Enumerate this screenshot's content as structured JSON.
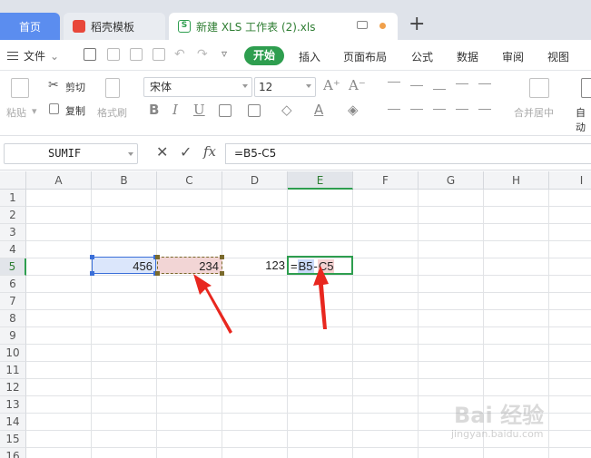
{
  "tabs": {
    "home": "首页",
    "daoke": "稻壳模板",
    "doc": "新建 XLS 工作表 (2).xls",
    "new_tab": "+"
  },
  "menu": {
    "file": "文件",
    "items": [
      "开始",
      "插入",
      "页面布局",
      "公式",
      "数据",
      "审阅",
      "视图"
    ]
  },
  "ribbon": {
    "paste": "粘贴",
    "cut": "剪切",
    "copy": "复制",
    "format_painter": "格式刷",
    "font_name": "宋体",
    "font_size": "12",
    "merge_center": "合并居中",
    "autowrap": "自动"
  },
  "formula_bar": {
    "name_box": "SUMIF",
    "fx": "fx",
    "formula": "=B5-C5"
  },
  "grid": {
    "columns": [
      "A",
      "B",
      "C",
      "D",
      "E",
      "F",
      "G",
      "H",
      "I"
    ],
    "selected_column": "E",
    "rows": [
      "1",
      "2",
      "3",
      "4",
      "5",
      "6",
      "7",
      "8",
      "9",
      "10",
      "11",
      "12",
      "13",
      "14",
      "15",
      "16"
    ],
    "selected_row": "5",
    "cells": {
      "B5": "456",
      "C5": "234",
      "D5": "123",
      "E5_eq": "=",
      "E5_ref1": "B5",
      "E5_op": "-",
      "E5_ref2": "C5"
    }
  },
  "colors": {
    "accent_green": "#2e9e4f",
    "home_tab_blue": "#5b8def",
    "ref_blue": "#3b6fd8",
    "arrow_red": "#e8271f"
  },
  "watermark": {
    "brand": "Bai 经验",
    "url": "jingyan.baidu.com"
  }
}
